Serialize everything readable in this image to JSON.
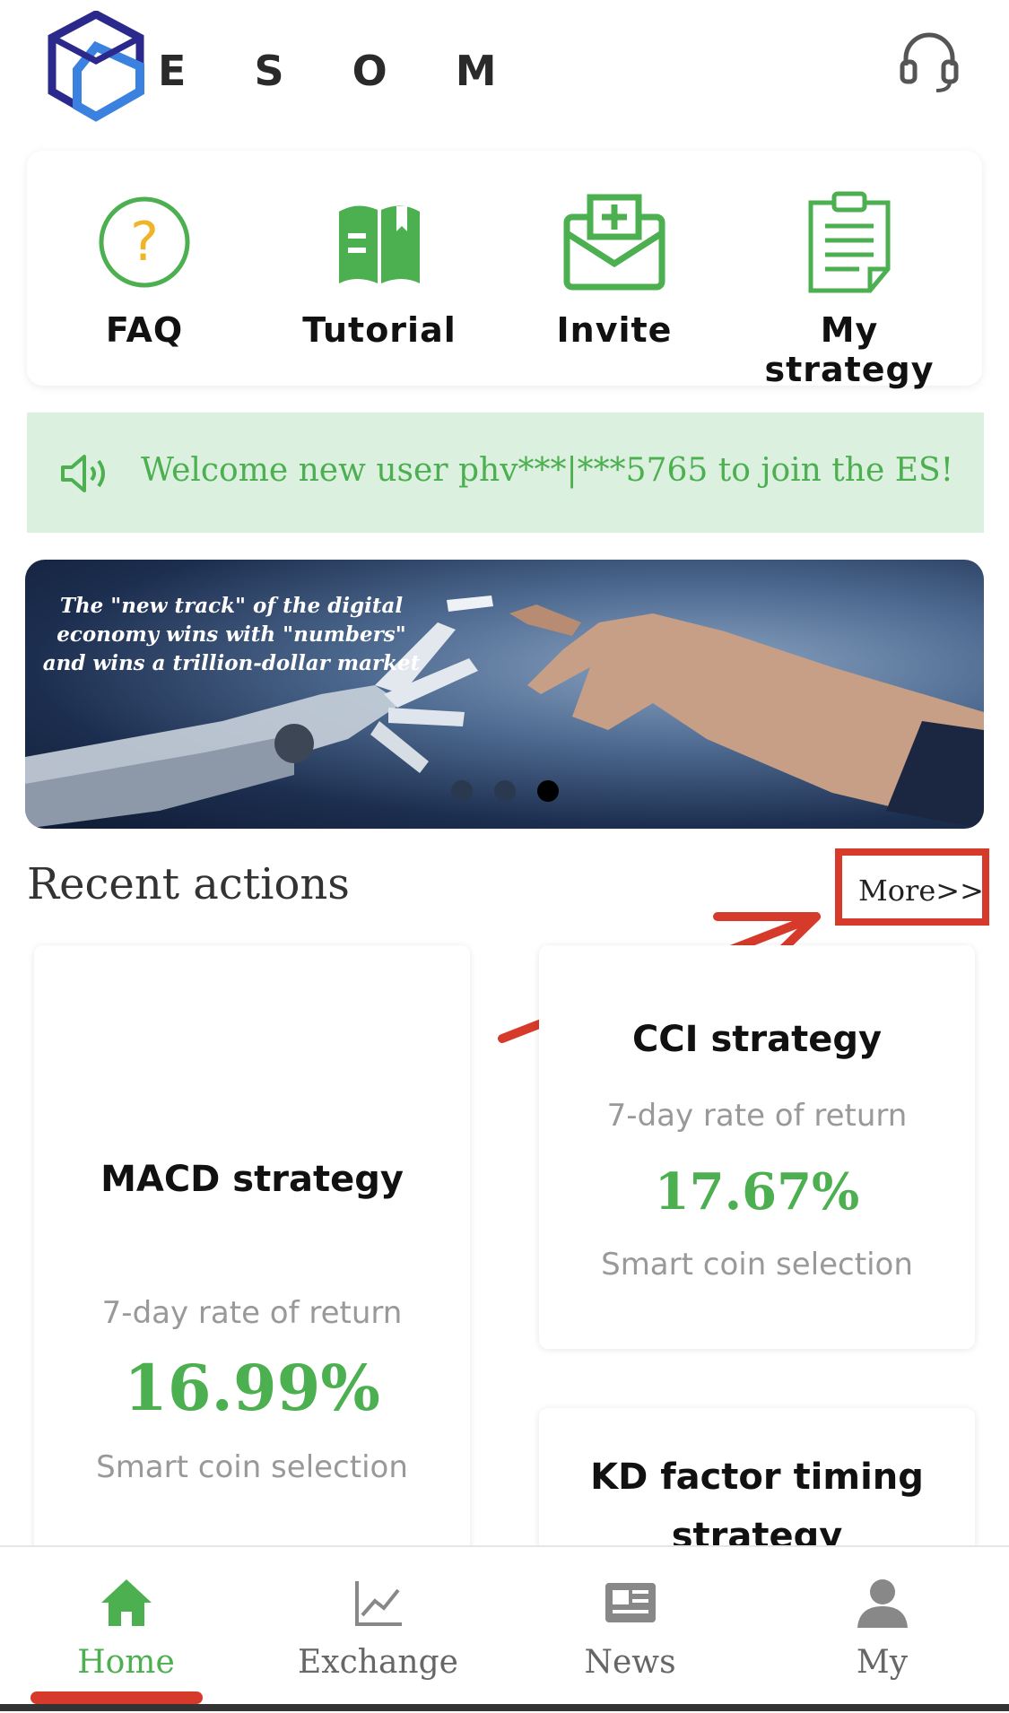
{
  "header": {
    "brand": "E S O M",
    "logo_icon": "esom-cube-logo",
    "support_icon": "headset-icon"
  },
  "quick_menu": [
    {
      "label": "FAQ",
      "icon": "question-circle-icon"
    },
    {
      "label": "Tutorial",
      "icon": "book-icon"
    },
    {
      "label": "Invite",
      "icon": "envelope-plus-icon"
    },
    {
      "label": "My strategy",
      "icon": "clipboard-list-icon"
    }
  ],
  "notice": {
    "icon": "speaker-icon",
    "text": "Welcome new user phv***|***5765 to join the ES!"
  },
  "banner": {
    "text": "The \"new track\" of the digital economy wins with \"numbers\" and wins a trillion-dollar market",
    "slide_count": 3,
    "active_slide": 3
  },
  "recent": {
    "title": "Recent actions",
    "more_label": "More>>",
    "cards": [
      {
        "name": "MACD strategy",
        "return_label": "7-day rate of return",
        "rate": "16.99%",
        "tag": "Smart coin selection"
      },
      {
        "name": "CCI strategy",
        "return_label": "7-day rate of return",
        "rate": "17.67%",
        "tag": "Smart coin selection"
      },
      {
        "name": "KD factor timing strategy"
      }
    ]
  },
  "tabbar": {
    "items": [
      {
        "label": "Home",
        "icon": "home-icon",
        "active": true
      },
      {
        "label": "Exchange",
        "icon": "line-chart-icon",
        "active": false
      },
      {
        "label": "News",
        "icon": "newspaper-icon",
        "active": false
      },
      {
        "label": "My",
        "icon": "user-icon",
        "active": false
      }
    ]
  },
  "colors": {
    "accent_green": "#4caf50",
    "notice_bg": "#dcf0df",
    "highlight_red": "#d63a2a",
    "logo_blue": "#3b82e0",
    "logo_navy": "#2b2a8c"
  }
}
